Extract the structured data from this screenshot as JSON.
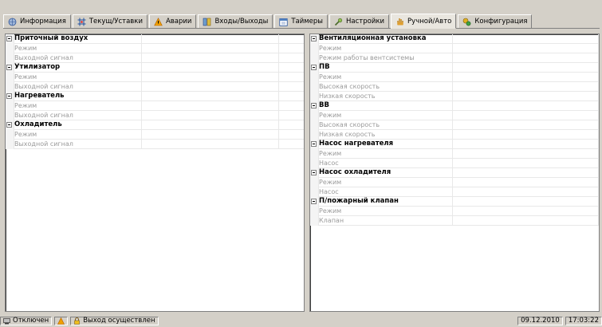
{
  "tabs": [
    {
      "label": "Информация",
      "icon": "globe-icon"
    },
    {
      "label": "Текущ/Уставки",
      "icon": "crosshair-icon"
    },
    {
      "label": "Аварии",
      "icon": "warning-icon"
    },
    {
      "label": "Входы/Выходы",
      "icon": "io-icon"
    },
    {
      "label": "Таймеры",
      "icon": "calendar-icon"
    },
    {
      "label": "Настройки",
      "icon": "wrench-icon"
    },
    {
      "label": "Ручной/Авто",
      "icon": "hand-icon",
      "active": true
    },
    {
      "label": "Конфигурация",
      "icon": "config-icon"
    }
  ],
  "left_panel": [
    {
      "group": "Приточный воздух",
      "items": [
        "Режим",
        "Выходной сигнал"
      ]
    },
    {
      "group": "Утилизатор",
      "items": [
        "Режим",
        "Выходной сигнал"
      ]
    },
    {
      "group": "Нагреватель",
      "items": [
        "Режим",
        "Выходной сигнал"
      ]
    },
    {
      "group": "Охладитель",
      "items": [
        "Режим",
        "Выходной сигнал"
      ]
    }
  ],
  "right_panel": [
    {
      "group": "Вентиляционная установка",
      "items": [
        "Режим",
        "Режим работы вентсистемы"
      ]
    },
    {
      "group": "ПВ",
      "items": [
        "Режим",
        "Высокая скорость",
        "Низкая скорость"
      ]
    },
    {
      "group": "ВВ",
      "items": [
        "Режим",
        "Высокая скорость",
        "Низкая скорость"
      ]
    },
    {
      "group": "Насос нагревателя",
      "items": [
        "Режим",
        "Насос"
      ]
    },
    {
      "group": "Насос охладителя",
      "items": [
        "Режим",
        "Насос"
      ]
    },
    {
      "group": "П/пожарный клапан",
      "items": [
        "Режим",
        "Клапан"
      ]
    }
  ],
  "status": {
    "connection": "Отключен",
    "login": "Выход осуществлен",
    "date": "09.12.2010",
    "time": "17:03:22"
  },
  "colors": {
    "accent_warning": "#f0a000"
  }
}
